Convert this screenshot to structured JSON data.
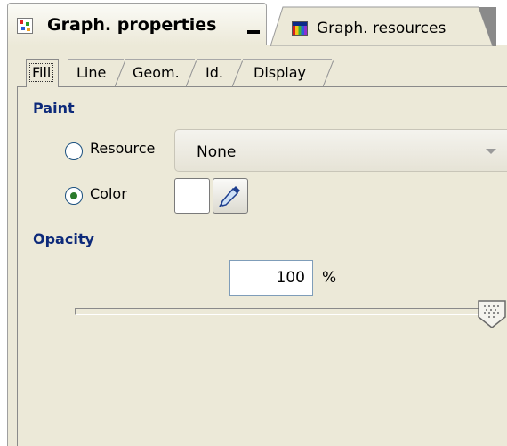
{
  "header": {
    "active_tab_title": "Graph. properties",
    "active_tab_icon": "graph-properties-icon",
    "minimize_icon": "minimize-icon",
    "other_tab_title": "Graph. resources",
    "other_tab_icon": "graph-resources-icon"
  },
  "inner_tabs": [
    "Fill",
    "Line",
    "Geom.",
    "Id.",
    "Display"
  ],
  "active_inner_tab": "Fill",
  "paint": {
    "title": "Paint",
    "resource_label": "Resource",
    "resource_value": "None",
    "color_label": "Color",
    "selected_option": "Color",
    "color_swatch": "#ffffff",
    "picker_icon": "eyedropper-icon"
  },
  "opacity": {
    "title": "Opacity",
    "value": "100",
    "unit": "%",
    "slider_level": 1.0
  },
  "colors": {
    "panel_bg": "#ece9d8",
    "group_title": "#0d2a7a",
    "radio_checked": "#2b7a2b"
  }
}
